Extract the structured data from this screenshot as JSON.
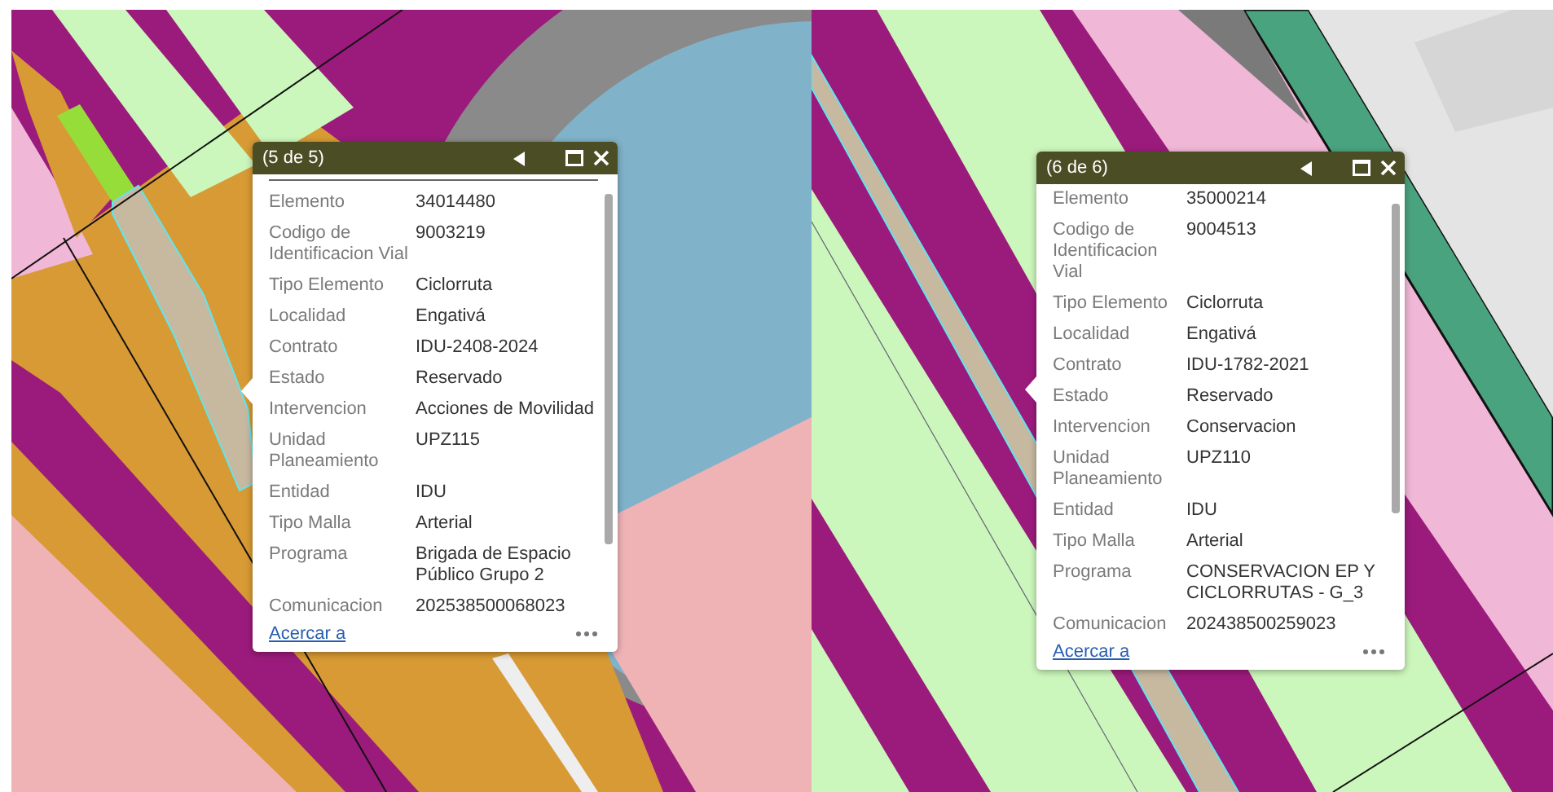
{
  "panels": [
    {
      "popup": {
        "title": "(5 de 5)",
        "top_rule": true,
        "fields": [
          {
            "label": "Elemento",
            "value": "34014480"
          },
          {
            "label": "Codigo de Identificacion Vial",
            "value": "9003219"
          },
          {
            "label": "Tipo Elemento",
            "value": "Ciclorruta"
          },
          {
            "label": "Localidad",
            "value": "Engativá"
          },
          {
            "label": "Contrato",
            "value": "IDU-2408-2024"
          },
          {
            "label": "Estado",
            "value": "Reservado"
          },
          {
            "label": "Intervencion",
            "value": "Acciones de Movilidad"
          },
          {
            "label": "Unidad Planeamiento",
            "value": "UPZ115"
          },
          {
            "label": "Entidad",
            "value": "IDU"
          },
          {
            "label": "Tipo Malla",
            "value": "Arterial"
          },
          {
            "label": "Programa",
            "value": "Brigada de Espacio Público Grupo 2"
          },
          {
            "label": "Comunicacion",
            "value": "202538500068023"
          }
        ],
        "link": "Acercar a"
      }
    },
    {
      "popup": {
        "title": "(6 de 6)",
        "top_rule": false,
        "fields": [
          {
            "label": "Elemento",
            "value": "35000214"
          },
          {
            "label": "Codigo de Identificacion Vial",
            "value": "9004513"
          },
          {
            "label": "Tipo Elemento",
            "value": "Ciclorruta"
          },
          {
            "label": "Localidad",
            "value": "Engativá"
          },
          {
            "label": "Contrato",
            "value": "IDU-1782-2021"
          },
          {
            "label": "Estado",
            "value": "Reservado"
          },
          {
            "label": "Intervencion",
            "value": "Conservacion"
          },
          {
            "label": "Unidad Planeamiento",
            "value": "UPZ110"
          },
          {
            "label": "Entidad",
            "value": "IDU"
          },
          {
            "label": "Tipo Malla",
            "value": "Arterial"
          },
          {
            "label": "Programa",
            "value": "CONSERVACION EP Y CICLORRUTAS - G_3"
          },
          {
            "label": "Comunicacion",
            "value": "202438500259023"
          }
        ],
        "link": "Acercar a"
      }
    }
  ]
}
